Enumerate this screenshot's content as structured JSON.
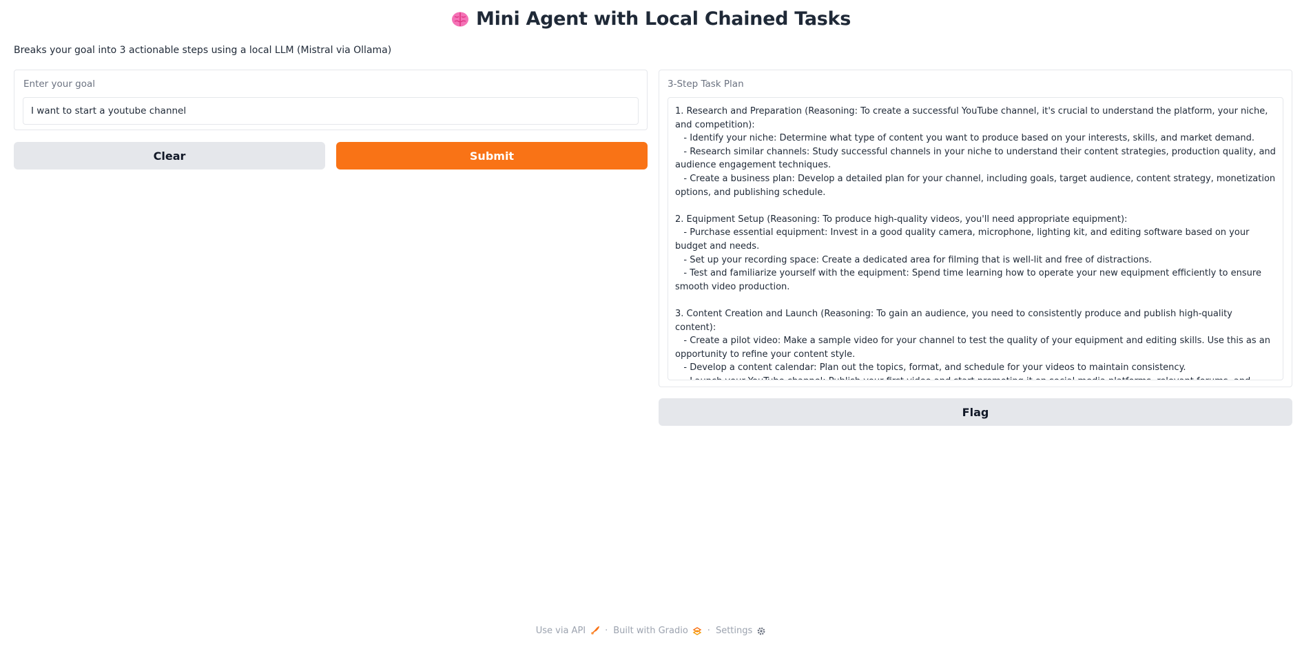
{
  "header": {
    "title": "Mini Agent with Local Chained Tasks",
    "icon": "brain-icon",
    "description": "Breaks your goal into 3 actionable steps using a local LLM (Mistral via Ollama)"
  },
  "goal": {
    "label": "Enter your goal",
    "value": "I want to start a youtube channel"
  },
  "buttons": {
    "clear": "Clear",
    "submit": "Submit",
    "flag": "Flag"
  },
  "plan": {
    "label": "3-Step Task Plan",
    "lines": [
      "1. Research and Preparation (Reasoning: To create a successful YouTube channel, it's crucial to understand the platform, your niche, and competition):",
      "   - Identify your niche: Determine what type of content you want to produce based on your interests, skills, and market demand.",
      "   - Research similar channels: Study successful channels in your niche to understand their content strategies, production quality, and audience engagement techniques.",
      "   - Create a business plan: Develop a detailed plan for your channel, including goals, target audience, content strategy, monetization options, and publishing schedule.",
      "",
      "2. Equipment Setup (Reasoning: To produce high-quality videos, you'll need appropriate equipment):",
      "   - Purchase essential equipment: Invest in a good quality camera, microphone, lighting kit, and editing software based on your budget and needs.",
      "   - Set up your recording space: Create a dedicated area for filming that is well-lit and free of distractions.",
      "   - Test and familiarize yourself with the equipment: Spend time learning how to operate your new equipment efficiently to ensure smooth video production.",
      "",
      "3. Content Creation and Launch (Reasoning: To gain an audience, you need to consistently produce and publish high-quality content):",
      "   - Create a pilot video: Make a sample video for your channel to test the quality of your equipment and editing skills. Use this as an opportunity to refine your content style.",
      "   - Develop a content calendar: Plan out the topics, format, and schedule for your videos to maintain consistency.",
      "   - Launch your YouTube channel: Publish your first video and start promoting it on social media platforms, relevant forums, and websites. Engage with your audience by responding to comments and encouraging viewer interaction. Continuously create and publish quality content to grow your subscriber base."
    ]
  },
  "footer": {
    "api": "Use via API",
    "api_icon": "rocket-icon",
    "gradio": "Built with Gradio",
    "gradio_icon": "gradio-logo-icon",
    "settings": "Settings",
    "settings_icon": "gear-icon",
    "separator": "·"
  },
  "colors": {
    "accent": "#f97316",
    "secondary_button": "#e5e7eb",
    "border": "#e5e7eb",
    "muted_text": "#6b7280"
  }
}
